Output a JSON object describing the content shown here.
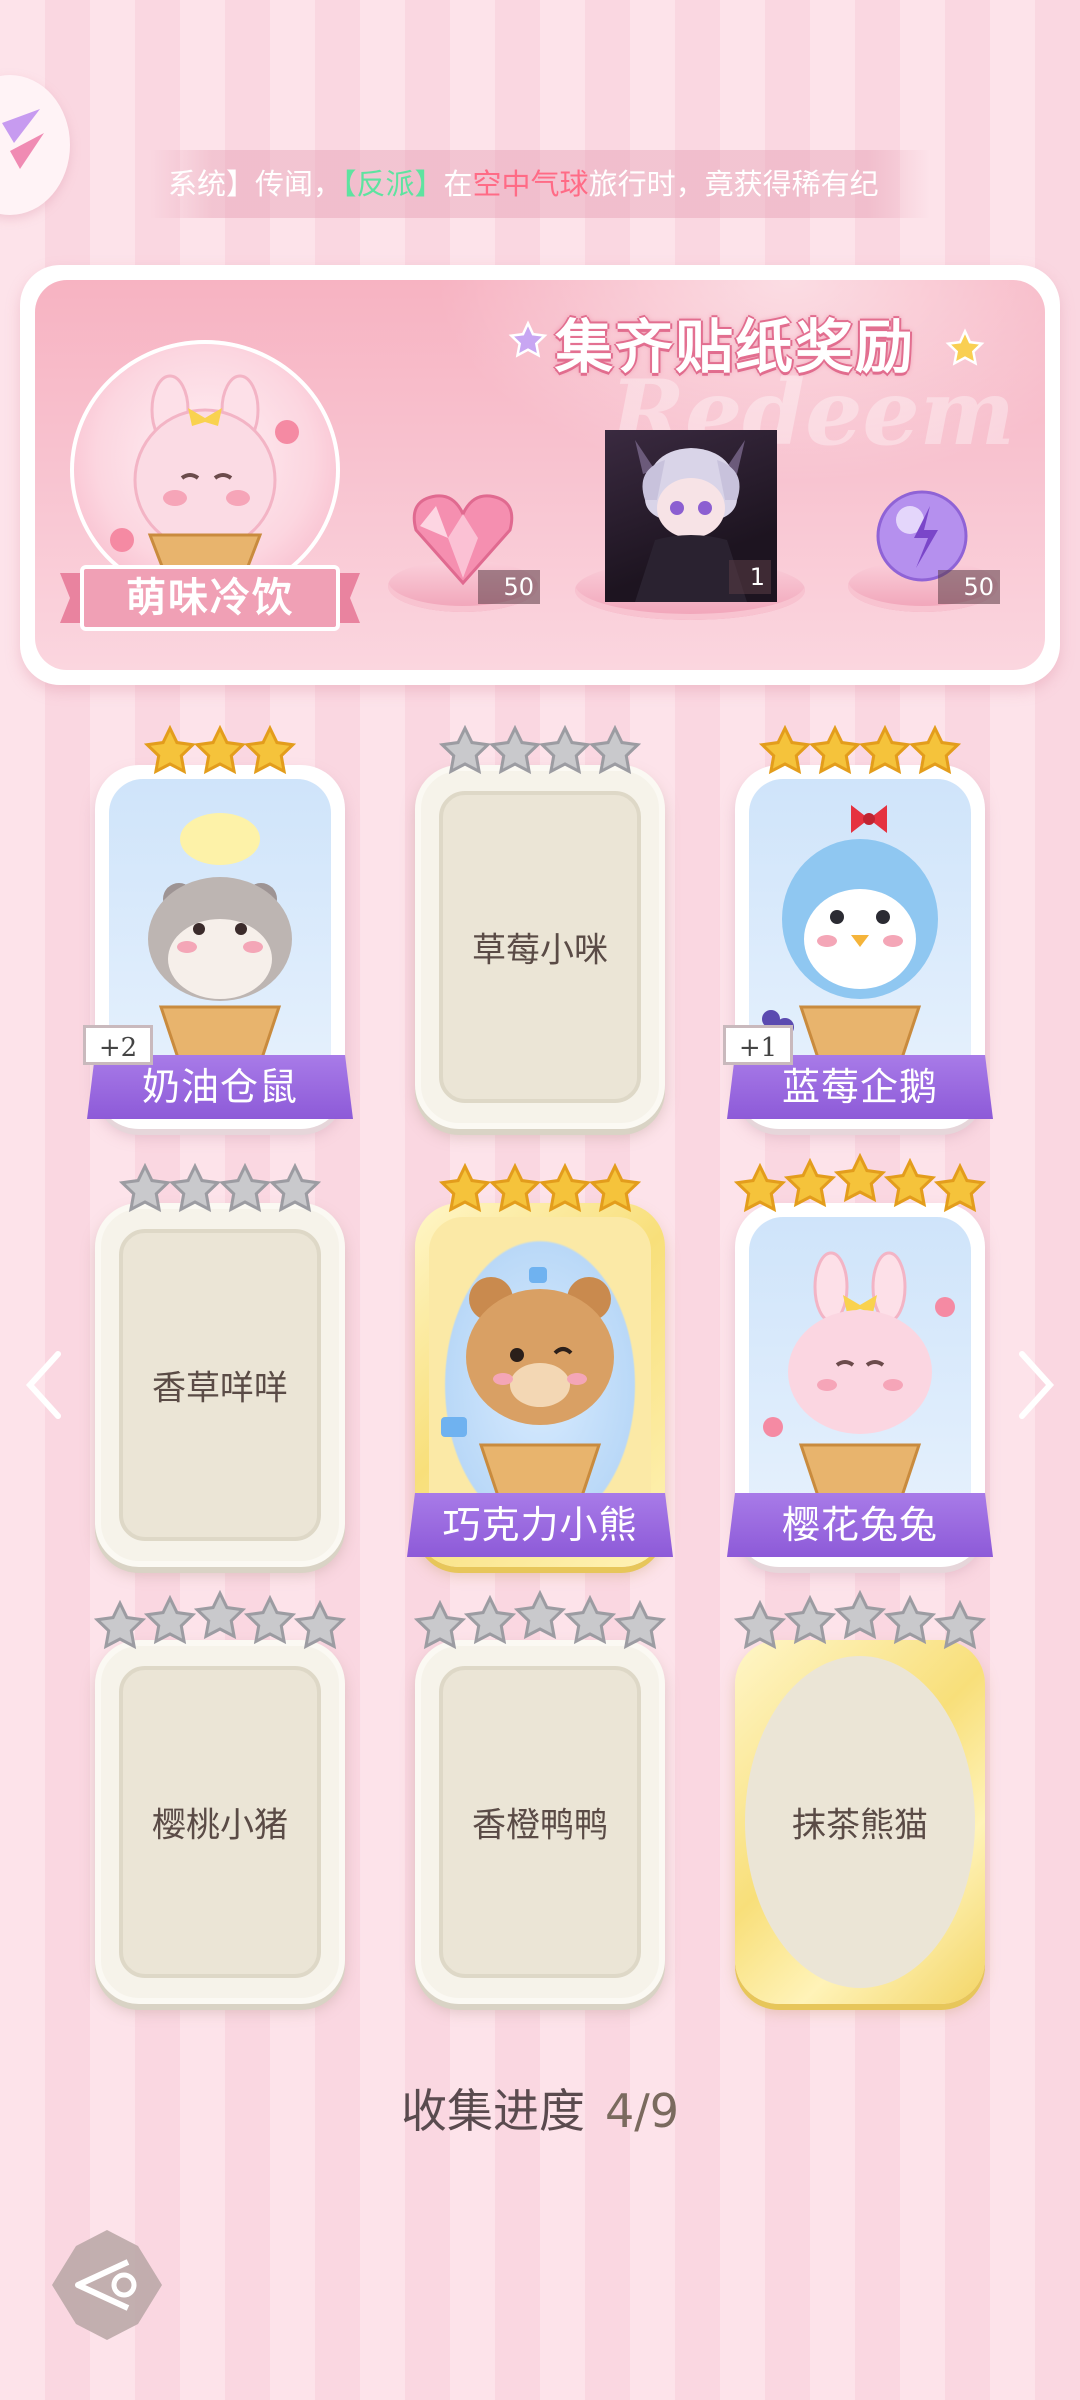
{
  "announcement": {
    "prefix": "系统】传闻，",
    "faction": "【反派】",
    "mid1": "在",
    "place": "空中气球",
    "suffix": "旅行时，竟获得稀有纪"
  },
  "reward_panel": {
    "title": "集齐贴纸奖励",
    "watermark": "Redeem",
    "theme_name": "萌味冷饮",
    "rewards": [
      {
        "icon": "pink-heart-gem-icon",
        "count": "50"
      },
      {
        "icon": "character-avatar",
        "count": "1"
      },
      {
        "icon": "purple-energy-orb-icon",
        "count": "50"
      }
    ]
  },
  "stickers": [
    {
      "name": "奶油仓鼠",
      "stars": 3,
      "collected": true,
      "badge": "+2"
    },
    {
      "name": "草莓小咪",
      "stars": 4,
      "collected": false
    },
    {
      "name": "蓝莓企鹅",
      "stars": 4,
      "collected": true,
      "badge": "+1"
    },
    {
      "name": "香草咩咩",
      "stars": 4,
      "collected": false
    },
    {
      "name": "巧克力小熊",
      "stars": 4,
      "collected": true
    },
    {
      "name": "樱花兔兔",
      "stars": 5,
      "collected": true
    },
    {
      "name": "樱桃小猪",
      "stars": 5,
      "collected": false
    },
    {
      "name": "香橙鸭鸭",
      "stars": 5,
      "collected": false
    },
    {
      "name": "抹茶熊猫",
      "stars": 5,
      "collected": false
    }
  ],
  "progress": {
    "label": "收集进度",
    "value": "4/9"
  },
  "colors": {
    "star_gold": "#f5c33b",
    "star_silver": "#c9c9cc",
    "banner_purple": "#9a67de",
    "accent_pink": "#f4a6bb"
  }
}
